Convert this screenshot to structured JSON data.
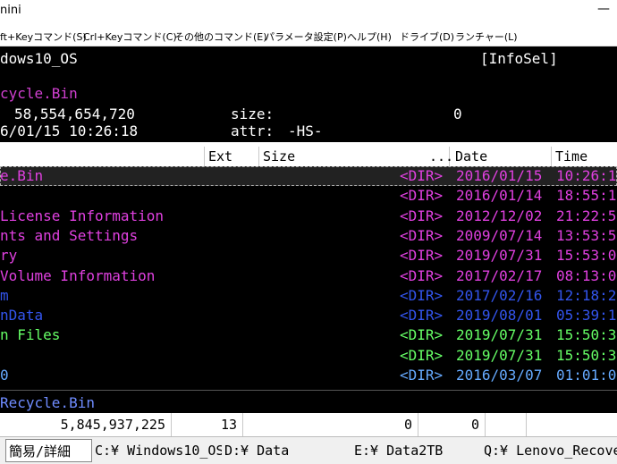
{
  "window": {
    "title": "nini",
    "minimize_glyph": "—"
  },
  "menu": [
    {
      "label": "ft+Keyコマンド(S)"
    },
    {
      "label": "Crl+Keyコマンド(C)"
    },
    {
      "label": "その他のコマンド(E)"
    },
    {
      "label": "パラメータ設定(P)"
    },
    {
      "label": "ヘルプ(H)"
    },
    {
      "label": "ドライブ(D)"
    },
    {
      "label": "ランチャー(L)"
    }
  ],
  "info": {
    "volume": "dows10_OS",
    "infosel": "[InfoSel]",
    "path": "cycle.Bin",
    "free": "58,554,654,720",
    "size_label": "size:",
    "size_value": "0",
    "datetime": "6/01/15 10:26:18",
    "attr_label": "attr:",
    "attr_value": "-HS-"
  },
  "columns": {
    "ext": "Ext",
    "size": "Size",
    "dots": "...",
    "date": "Date",
    "time": "Time"
  },
  "files": [
    {
      "name": "e.Bin",
      "type": "<DIR>",
      "date": "2016/01/15",
      "time": "10:26:1",
      "color": "#e040e0",
      "selected": true
    },
    {
      "name": "",
      "type": "<DIR>",
      "date": "2016/01/14",
      "time": "18:55:1",
      "color": "#e040e0",
      "selected": false
    },
    {
      "name": " License Information",
      "type": "<DIR>",
      "date": "2012/12/02",
      "time": "21:22:5",
      "color": "#e040e0",
      "selected": false
    },
    {
      "name": "nts and Settings",
      "type": "<DIR>",
      "date": "2009/07/14",
      "time": "13:53:5",
      "color": "#e040e0",
      "selected": false
    },
    {
      "name": "ry",
      "type": "<DIR>",
      "date": "2019/07/31",
      "time": "15:53:0",
      "color": "#e040e0",
      "selected": false
    },
    {
      "name": " Volume Information",
      "type": "<DIR>",
      "date": "2017/02/17",
      "time": "08:13:0",
      "color": "#e040e0",
      "selected": false
    },
    {
      "name": "m",
      "type": "<DIR>",
      "date": "2017/02/16",
      "time": "12:18:2",
      "color": "#3355ee",
      "selected": false
    },
    {
      "name": "nData",
      "type": "<DIR>",
      "date": "2019/08/01",
      "time": "05:39:1",
      "color": "#3355ee",
      "selected": false
    },
    {
      "name": "n Files",
      "type": "<DIR>",
      "date": "2019/07/31",
      "time": "15:50:3",
      "color": "#66ff66",
      "selected": false
    },
    {
      "name": "",
      "type": "<DIR>",
      "date": "2019/07/31",
      "time": "15:50:3",
      "color": "#66ff66",
      "selected": false
    },
    {
      "name": "0",
      "type": "<DIR>",
      "date": "2016/03/07",
      "time": "01:01:0",
      "color": "#66aaff",
      "selected": false
    }
  ],
  "bottom_path": "Recycle.Bin",
  "status": {
    "total": "5,845,937,225",
    "count": "13",
    "size": "0",
    "other": "0"
  },
  "tabs": [
    {
      "label": "簡易/詳細"
    },
    {
      "label": "C:¥ Windows10_OS"
    },
    {
      "label": "D:¥ Data"
    },
    {
      "label": "E:¥ Data2TB"
    },
    {
      "label": "Q:¥ Lenovo_Recovery"
    }
  ],
  "colors": {
    "info_bg": "#000000",
    "dir_tag": "#e040e0",
    "selected_bg": "#222222"
  }
}
